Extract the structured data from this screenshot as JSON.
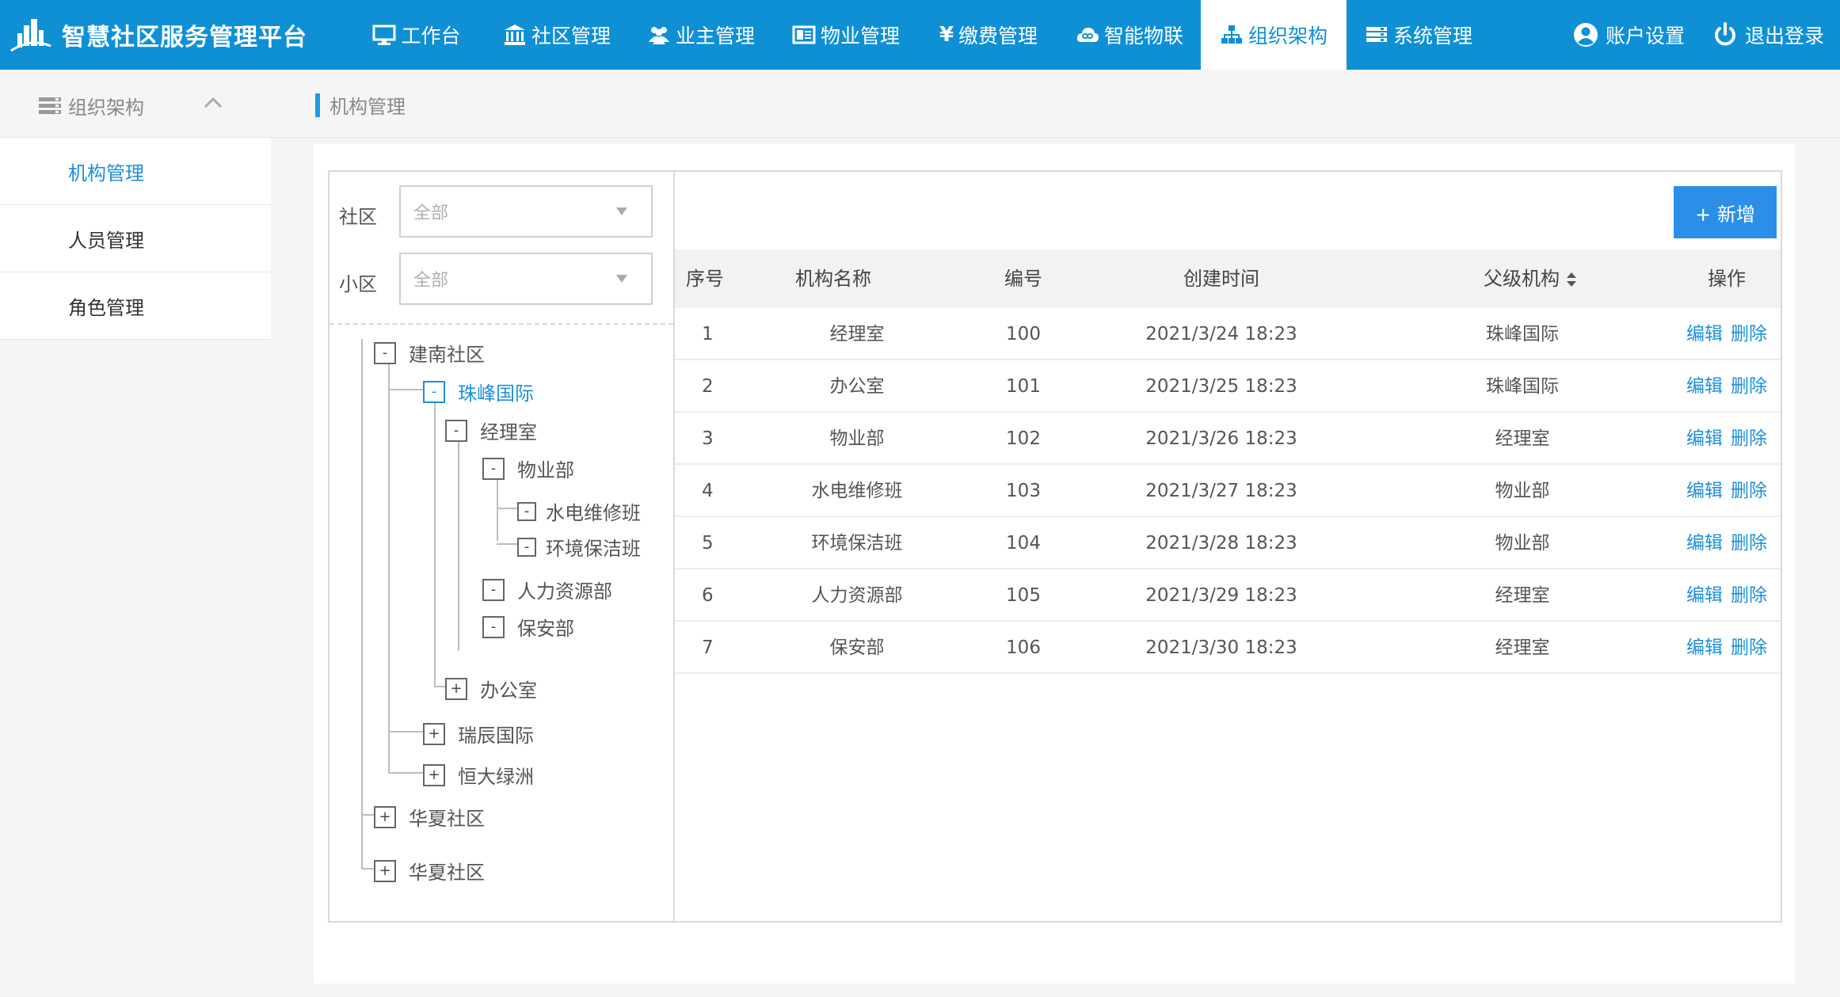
{
  "app": {
    "title": "智慧社区服务管理平台"
  },
  "nav": [
    {
      "label": "工作台",
      "icon": "monitor-icon"
    },
    {
      "label": "社区管理",
      "icon": "building-icon"
    },
    {
      "label": "业主管理",
      "icon": "users-icon"
    },
    {
      "label": "物业管理",
      "icon": "card-icon"
    },
    {
      "label": "缴费管理",
      "icon": "yen-icon"
    },
    {
      "label": "智能物联",
      "icon": "cloud-link-icon"
    },
    {
      "label": "组织架构",
      "icon": "org-chart-icon",
      "active": true
    },
    {
      "label": "系统管理",
      "icon": "server-icon"
    }
  ],
  "user": {
    "account_label": "账户设置",
    "logout_label": "退出登录"
  },
  "sidebar": {
    "header": "组织架构",
    "items": [
      {
        "label": "机构管理",
        "active": true
      },
      {
        "label": "人员管理"
      },
      {
        "label": "角色管理"
      }
    ]
  },
  "breadcrumb": "机构管理",
  "filters": {
    "community_label": "社区",
    "community_value": "全部",
    "estate_label": "小区",
    "estate_value": "全部"
  },
  "tree": [
    {
      "label": "建南社区",
      "toggle": "-"
    },
    {
      "label": "珠峰国际",
      "toggle": "-",
      "selected": true
    },
    {
      "label": "经理室",
      "toggle": "-"
    },
    {
      "label": "物业部",
      "toggle": "-"
    },
    {
      "label": "水电维修班",
      "toggle": "-"
    },
    {
      "label": "环境保洁班",
      "toggle": "-"
    },
    {
      "label": "人力资源部",
      "toggle": "-"
    },
    {
      "label": "保安部",
      "toggle": "-"
    },
    {
      "label": "办公室",
      "toggle": "+"
    },
    {
      "label": "瑞辰国际",
      "toggle": "+"
    },
    {
      "label": "恒大绿洲",
      "toggle": "+"
    },
    {
      "label": "华夏社区",
      "toggle": "+"
    },
    {
      "label": "华夏社区",
      "toggle": "+"
    }
  ],
  "table": {
    "add_label": "+ 新增",
    "columns": [
      "序号",
      "机构名称",
      "编号",
      "创建时间",
      "父级机构",
      "操作"
    ],
    "edit_label": "编辑",
    "delete_label": "删除",
    "rows": [
      [
        "1",
        "经理室",
        "100",
        "2021/3/24 18:23",
        "珠峰国际"
      ],
      [
        "2",
        "办公室",
        "101",
        "2021/3/25 18:23",
        "珠峰国际"
      ],
      [
        "3",
        "物业部",
        "102",
        "2021/3/26 18:23",
        "经理室"
      ],
      [
        "4",
        "水电维修班",
        "103",
        "2021/3/27 18:23",
        "物业部"
      ],
      [
        "5",
        "环境保洁班",
        "104",
        "2021/3/28 18:23",
        "物业部"
      ],
      [
        "6",
        "人力资源部",
        "105",
        "2021/3/29 18:23",
        "经理室"
      ],
      [
        "7",
        "保安部",
        "106",
        "2021/3/30 18:23",
        "经理室"
      ]
    ]
  },
  "colors": {
    "primary": "#0f90d4",
    "link": "#1e8fd6",
    "button": "#2b8fe8"
  }
}
